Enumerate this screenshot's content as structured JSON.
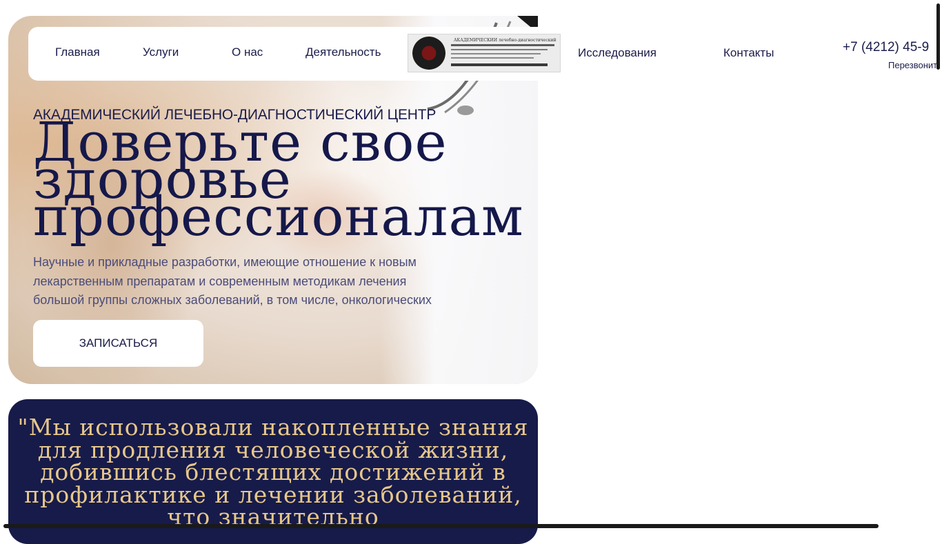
{
  "nav": {
    "items": [
      {
        "label": "Главная"
      },
      {
        "label": "Услуги"
      },
      {
        "label": "О нас"
      },
      {
        "label": "Деятельность"
      },
      {
        "label": "Исследования"
      },
      {
        "label": "Контакты"
      }
    ]
  },
  "logo": {
    "caption": "АКАДЕМИЧЕСКИЙ лечебно-диагностический центр"
  },
  "contact": {
    "phone": "+7 (4212) 45-9",
    "callback": "Перезвонит"
  },
  "hero": {
    "eyebrow": "АКАДЕМИЧЕСКИЙ ЛЕЧЕБНО-ДИАГНОСТИЧЕСКИЙ ЦЕНТР",
    "headline": "Доверьте свое\nздоровье\nпрофессионалам",
    "lead": "Научные и прикладные разработки, имеющие отношение к новым лекарственным препаратам и современным методикам лечения большой группы сложных заболеваний, в том числе, онкологических",
    "cta_label": "ЗАПИСАТЬСЯ"
  },
  "quote": {
    "text": "\"Мы использовали накопленные знания для продления человеческой жизни, добившись блестящих достижений в профилактике и лечении заболеваний, что значительно"
  },
  "colors": {
    "navy": "#171b4a",
    "gold": "#e7c78a",
    "text": "#1a1c4a"
  }
}
